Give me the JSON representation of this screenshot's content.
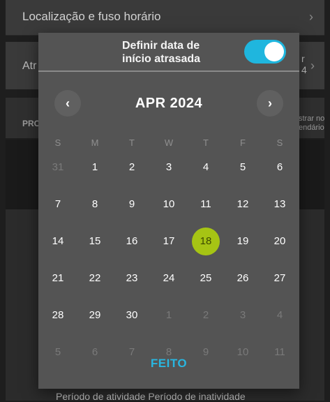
{
  "background": {
    "location_row": "Localização e fuso horário",
    "row2_left": "Atr",
    "row2_right_line1": "r",
    "row2_right_line2": "4",
    "section_label": "PRO",
    "right_small_line1": "strar no",
    "right_small_line2": "endário",
    "bottom_tabs": "Período de atividade     Período de inatividade"
  },
  "dialog": {
    "header_label": "Definir data de início atrasada",
    "toggle_on": true,
    "accent_color": "#1fb6de",
    "selected_color": "#a6c414",
    "month_title": "APR 2024",
    "prev_glyph": "‹",
    "next_glyph": "›",
    "weekdays": [
      "S",
      "M",
      "T",
      "W",
      "T",
      "F",
      "S"
    ],
    "weeks": [
      [
        {
          "d": "31",
          "out": true
        },
        {
          "d": "1"
        },
        {
          "d": "2"
        },
        {
          "d": "3"
        },
        {
          "d": "4"
        },
        {
          "d": "5"
        },
        {
          "d": "6"
        }
      ],
      [
        {
          "d": "7"
        },
        {
          "d": "8"
        },
        {
          "d": "9"
        },
        {
          "d": "10"
        },
        {
          "d": "11"
        },
        {
          "d": "12"
        },
        {
          "d": "13"
        }
      ],
      [
        {
          "d": "14"
        },
        {
          "d": "15"
        },
        {
          "d": "16"
        },
        {
          "d": "17"
        },
        {
          "d": "18",
          "selected": true
        },
        {
          "d": "19"
        },
        {
          "d": "20"
        }
      ],
      [
        {
          "d": "21"
        },
        {
          "d": "22"
        },
        {
          "d": "23"
        },
        {
          "d": "24"
        },
        {
          "d": "25"
        },
        {
          "d": "26"
        },
        {
          "d": "27"
        }
      ],
      [
        {
          "d": "28"
        },
        {
          "d": "29"
        },
        {
          "d": "30"
        },
        {
          "d": "1",
          "out": true
        },
        {
          "d": "2",
          "out": true
        },
        {
          "d": "3",
          "out": true
        },
        {
          "d": "4",
          "out": true
        }
      ],
      [
        {
          "d": "5",
          "out": true
        },
        {
          "d": "6",
          "out": true
        },
        {
          "d": "7",
          "out": true
        },
        {
          "d": "8",
          "out": true
        },
        {
          "d": "9",
          "out": true
        },
        {
          "d": "10",
          "out": true
        },
        {
          "d": "11",
          "out": true
        }
      ]
    ],
    "done_label": "FEITO"
  }
}
